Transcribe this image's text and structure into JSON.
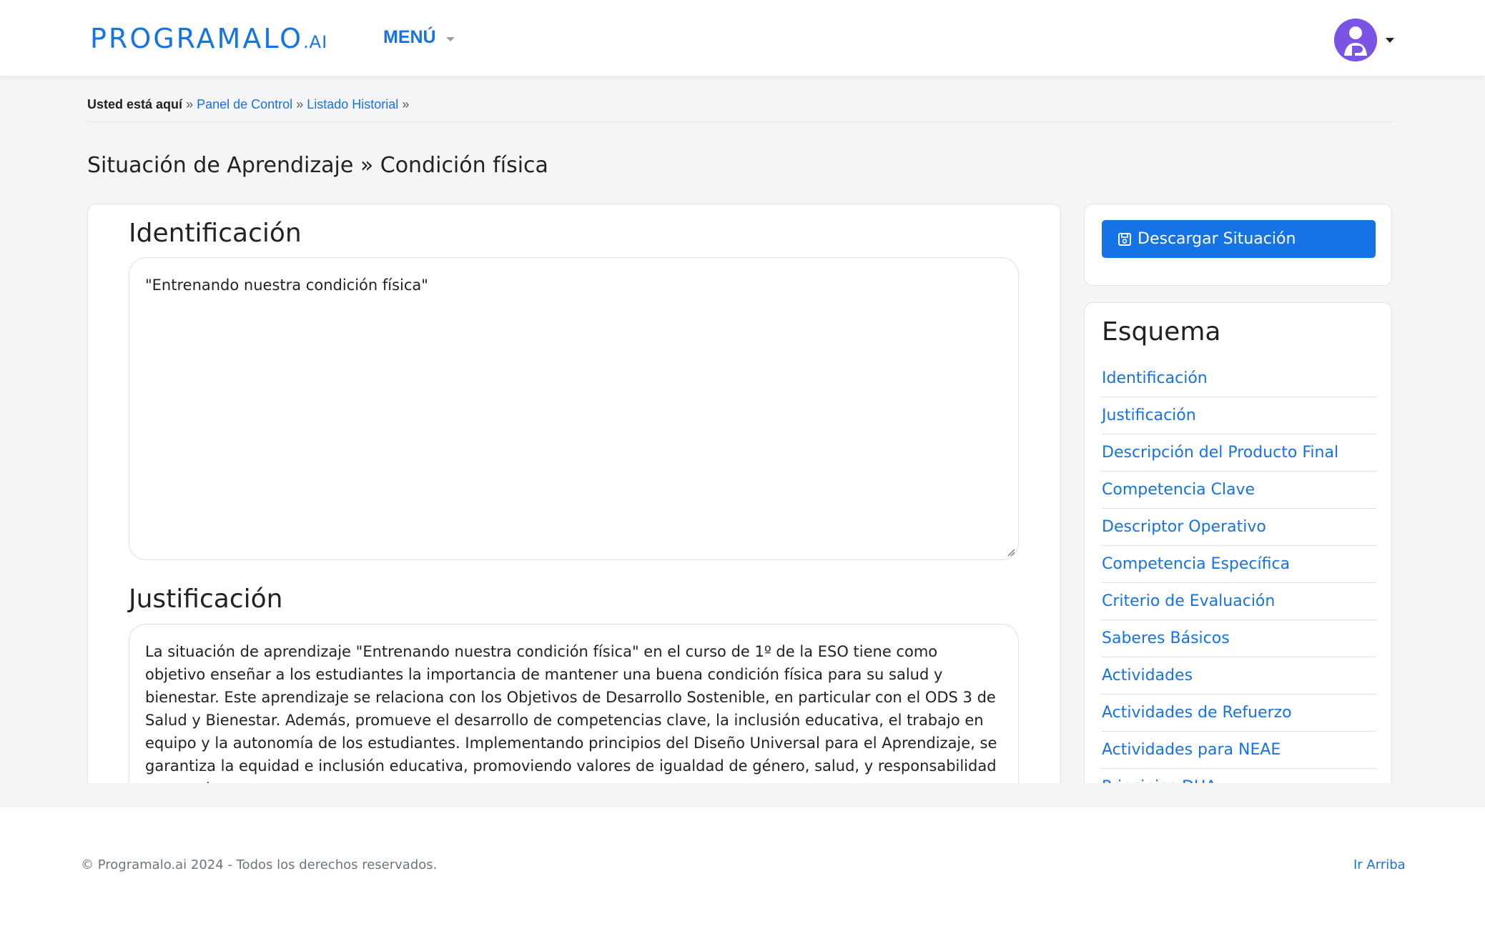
{
  "header": {
    "logo_main": "PROGRAMALO",
    "logo_ai": ".AI",
    "menu_label": "MENÚ",
    "avatar_icon": "user-avatar-icon"
  },
  "breadcrumb": {
    "prefix": "Usted está aquí",
    "sep": "»",
    "items": [
      "Panel de Control",
      "Listado Historial"
    ]
  },
  "page": {
    "title": "Situación de Aprendizaje » Condición física"
  },
  "sections": {
    "identificacion": {
      "title": "Identificación",
      "text": "\"Entrenando nuestra condición física\""
    },
    "justificacion": {
      "title": "Justificación",
      "text": "La situación de aprendizaje \"Entrenando nuestra condición física\" en el curso de 1º de la ESO tiene como objetivo enseñar a los estudiantes la importancia de mantener una buena condición física para su salud y bienestar. Este aprendizaje se relaciona con los Objetivos de Desarrollo Sostenible, en particular con el ODS 3 de Salud y Bienestar. Además, promueve el desarrollo de competencias clave, la inclusión educativa, el trabajo en equipo y la autonomía de los estudiantes. Implementando principios del Diseño Universal para el Aprendizaje, se garantiza la equidad e inclusión educativa, promoviendo valores de igualdad de género, salud, y responsabilidad personal."
    }
  },
  "sidebar": {
    "download_label": "Descargar Situación",
    "download_icon": "save-icon",
    "esquema_title": "Esquema",
    "items": [
      "Identificación",
      "Justificación",
      "Descripción del Producto Final",
      "Competencia Clave",
      "Descriptor Operativo",
      "Competencia Específica",
      "Criterio de Evaluación",
      "Saberes Básicos",
      "Actividades",
      "Actividades de Refuerzo",
      "Actividades para NEAE",
      "Principios DUA"
    ]
  },
  "footer": {
    "copyright": "© Programalo.ai 2024 - Todos los derechos reservados.",
    "back_to_top": "Ir Arriba"
  },
  "colors": {
    "accent": "#1673e6",
    "avatar": "#7b54e6",
    "background": "#f4f5f7"
  }
}
